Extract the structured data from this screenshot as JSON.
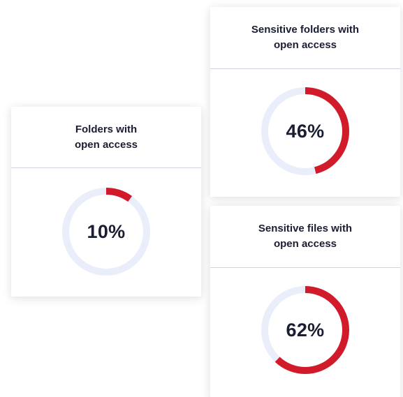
{
  "colors": {
    "ring_track": "#eaeefb",
    "ring_fill": "#d11a2a",
    "text": "#1b1d33",
    "divider": "#cfd3df"
  },
  "cards": [
    {
      "title_line1": "Folders with",
      "title_line2": "open access",
      "value": 10,
      "value_label": "10%"
    },
    {
      "title_line1": "Sensitive folders with",
      "title_line2": "open access",
      "value": 46,
      "value_label": "46%"
    },
    {
      "title_line1": "Sensitive files with",
      "title_line2": "open access",
      "value": 62,
      "value_label": "62%"
    }
  ]
}
